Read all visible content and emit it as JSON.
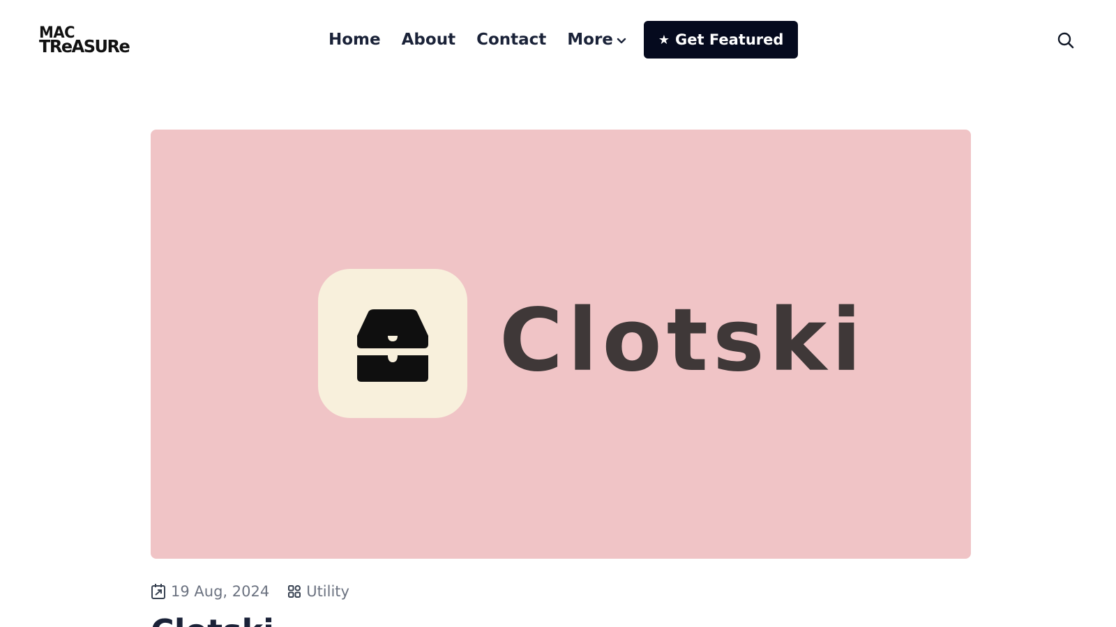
{
  "logo": {
    "line1": "MAC",
    "line2": "TReASURe"
  },
  "nav": {
    "home": "Home",
    "about": "About",
    "contact": "Contact",
    "more": "More",
    "cta_star": "★",
    "cta": "Get Featured"
  },
  "icons": {
    "search": "search-icon",
    "more_chevron": "chevron-down-icon",
    "date": "calendar-icon",
    "category": "grid-icon",
    "app": "inbox-tray-icon"
  },
  "hero": {
    "app_name": "Clotski",
    "background": "#f0c4c6",
    "icon_background": "#f8f0dc"
  },
  "post": {
    "date": "19 Aug, 2024",
    "category": "Utility",
    "title": "Clotski"
  },
  "colors": {
    "cta_background": "#050a1e",
    "nav_text": "#1a2238",
    "meta_text": "#6b7280"
  }
}
